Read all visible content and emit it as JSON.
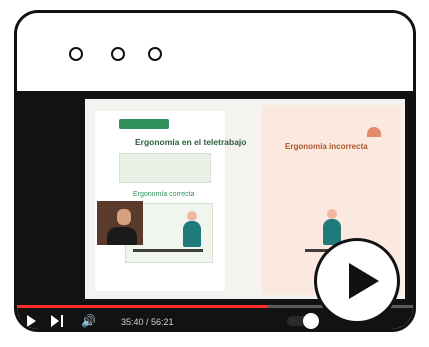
{
  "player": {
    "time_display": "35:40 / 56:21",
    "progress_fraction": 0.634,
    "slide": {
      "left_title": "Ergonomía en el teletrabajo",
      "left_subtitle": "Ergonomía correcta",
      "right_title": "Ergonomía incorrecta"
    }
  },
  "colors": {
    "accent_red": "#ff2a2a",
    "frame": "#111111",
    "slide_green": "#2f8f5a",
    "slide_orange": "#e38b6b"
  },
  "icons": {
    "window_dots": [
      "dot-icon",
      "dot-icon",
      "dot-icon"
    ],
    "play": "play-icon",
    "next": "next-icon",
    "volume": "volume-icon",
    "toggle": "autoplay-toggle-icon",
    "big_play": "play-icon"
  }
}
